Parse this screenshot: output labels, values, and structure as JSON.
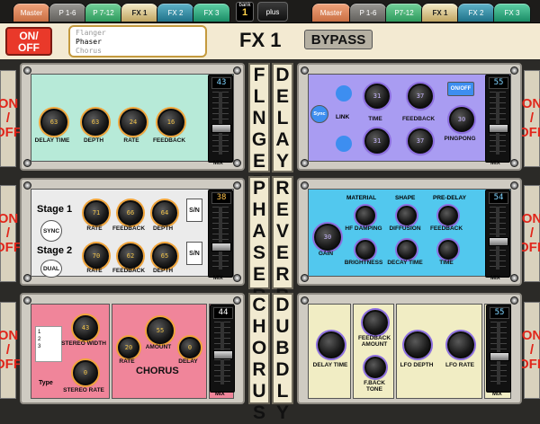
{
  "tabs_left": [
    "Master",
    "P 1-6",
    "P 7-12",
    "FX 1",
    "FX 2",
    "FX 3"
  ],
  "tabs_right": [
    "Master",
    "P 1-6",
    "P7-12",
    "FX 1",
    "FX 2",
    "FX 3"
  ],
  "bank": {
    "label": "bank",
    "value": "1"
  },
  "plus_label": "plus",
  "header": {
    "onoff_line1": "ON/",
    "onoff_line2": "OFF",
    "fx_list": [
      "Flanger",
      "Phaser",
      "Chorus"
    ],
    "title": "FX 1",
    "bypass_label": "BYPASS"
  },
  "side_onoff": {
    "line1": "ON",
    "line2": "/",
    "line3": "OFF"
  },
  "mix_label": "MIX",
  "flanger": {
    "name_letters": [
      "F",
      "L",
      "N",
      "G",
      "E",
      "R"
    ],
    "fader_value": "43",
    "knobs": [
      {
        "label": "DELAY TIME",
        "value": "63"
      },
      {
        "label": "DEPTH",
        "value": "63"
      },
      {
        "label": "RATE",
        "value": "24"
      },
      {
        "label": "FEEDBACK",
        "value": "16"
      }
    ]
  },
  "phaser": {
    "name_letters": [
      "P",
      "H",
      "A",
      "S",
      "E",
      "R"
    ],
    "fader_value": "38",
    "stage1_label": "Stage 1",
    "stage2_label": "Stage 2",
    "sync_label": "SYNC",
    "dual_label": "DUAL",
    "sn_label": "S/N",
    "stage1_knobs": [
      {
        "label": "RATE",
        "value": "71"
      },
      {
        "label": "FEEDBACK",
        "value": "66"
      },
      {
        "label": "DEPTH",
        "value": "64"
      }
    ],
    "stage2_knobs": [
      {
        "label": "RATE",
        "value": "70"
      },
      {
        "label": "FEEDBACK",
        "value": "62"
      },
      {
        "label": "DEPTH",
        "value": "65"
      }
    ]
  },
  "chorus": {
    "name_letters": [
      "C",
      "H",
      "O",
      "R",
      "U",
      "S"
    ],
    "fader_value": "44",
    "type_options": [
      "1",
      "2",
      "3"
    ],
    "type_label": "Type",
    "title": "CHORUS",
    "knobs": [
      {
        "label": "STEREO WIDTH",
        "value": "43"
      },
      {
        "label": "STEREO RATE",
        "value": "0"
      },
      {
        "label": "RATE",
        "value": "20"
      },
      {
        "label": "AMOUNT",
        "value": "55"
      },
      {
        "label": "DELAY",
        "value": "0"
      }
    ]
  },
  "delay": {
    "name_letters": [
      "D",
      "E",
      "L",
      "A",
      "Y"
    ],
    "fader_value": "55",
    "sync_label": "Sync",
    "link_label": "LINK",
    "onoff_label": "ON/OFF",
    "knobs": [
      {
        "label": "TIME",
        "value": "31"
      },
      {
        "label": "FEEDBACK",
        "value": "37"
      },
      {
        "label": "PINGPONG",
        "value": "30"
      },
      {
        "label": "",
        "value": "31"
      },
      {
        "label": "",
        "value": "37"
      }
    ]
  },
  "reverb": {
    "name_letters": [
      "R",
      "E",
      "V",
      "E",
      "R",
      "B"
    ],
    "fader_value": "54",
    "labels": {
      "material": "MATERIAL",
      "shape": "SHAPE",
      "predelay": "PRE-DELAY"
    },
    "knobs": [
      {
        "label": "GAIN",
        "value": "30"
      },
      {
        "label": "HF DAMPING",
        "value": ""
      },
      {
        "label": "DIFFUSION",
        "value": ""
      },
      {
        "label": "FEEDBACK",
        "value": ""
      },
      {
        "label": "BRIGHTNESS",
        "value": ""
      },
      {
        "label": "DECAY TIME",
        "value": ""
      },
      {
        "label": "TIME",
        "value": ""
      }
    ]
  },
  "dubdly": {
    "name_letters": [
      "D",
      "U",
      "B",
      "D",
      "L",
      "Y"
    ],
    "fader_value": "55",
    "knobs": [
      {
        "label": "DELAY TIME",
        "value": ""
      },
      {
        "label": "FEEDBACK AMOUNT",
        "value": ""
      },
      {
        "label": "F.BACK TONE",
        "value": ""
      },
      {
        "label": "LFO DEPTH",
        "value": ""
      },
      {
        "label": "LFO RATE",
        "value": ""
      }
    ]
  }
}
